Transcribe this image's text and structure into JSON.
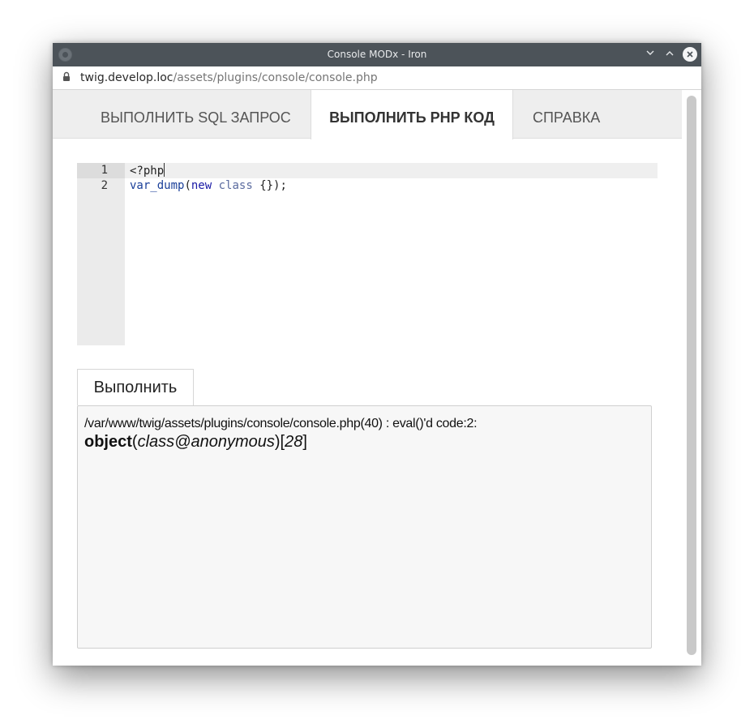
{
  "window": {
    "title": "Console MODx - Iron"
  },
  "address_bar": {
    "host": "twig.develop.loc",
    "path": "/assets/plugins/console/console.php"
  },
  "tabs": [
    {
      "label": "ВЫПОЛНИТЬ SQL ЗАПРОС",
      "active": false
    },
    {
      "label": "ВЫПОЛНИТЬ PHP КОД",
      "active": true
    },
    {
      "label": "СПРАВКА",
      "active": false
    }
  ],
  "editor": {
    "line_numbers": [
      "1",
      "2"
    ],
    "line1": "<?php",
    "line2": {
      "fn": "var_dump",
      "open": "(",
      "kw": "new",
      "cls": "class",
      "rest": "{});"
    }
  },
  "run_button": {
    "label": "Выполнить"
  },
  "output": {
    "location": "/var/www/twig/assets/plugins/console/console.php(40) : eval()'d code:2:",
    "type_word": "object",
    "paren_open": "(",
    "class_name": "class@anonymous",
    "paren_close": ")",
    "bracket_open": "[",
    "object_id": "28",
    "bracket_close": "]"
  },
  "colors": {
    "titlebar": "#4c5359",
    "tab_bar": "#eeeeee",
    "keyword": "#1a1aa6",
    "output_bg": "#f7f7f7"
  },
  "icons": [
    "app-icon",
    "minimize-icon",
    "maximize-icon",
    "close-icon",
    "lock-icon"
  ]
}
